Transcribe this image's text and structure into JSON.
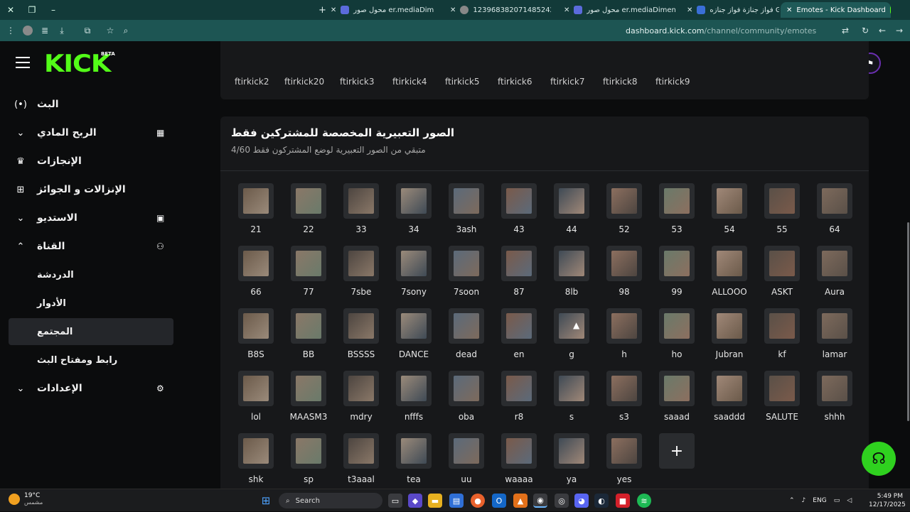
{
  "browser": {
    "tabs": [
      {
        "title": "Emotes - Kick Dashboard",
        "active": true
      },
      {
        "title": "فواز جنازة فواز جنازه GIF - فواز جـ",
        "active": false
      },
      {
        "title": "محول صور er.mediaDimension",
        "active": false
      },
      {
        "title": "1239683820714852424.webp (",
        "active": false
      },
      {
        "title": "محول صور er.mediaDimension",
        "active": false
      }
    ],
    "url_host": "dashboard.kick.com",
    "url_path": "/channel/community/emotes"
  },
  "header": {
    "logo": "KICK",
    "beta": "BETA"
  },
  "sidebar": {
    "items": [
      {
        "label": "البث",
        "icon": "live-icon"
      },
      {
        "label": "الربح المادي",
        "icon": "chart-icon",
        "chevron": "down"
      },
      {
        "label": "الإنجازات",
        "icon": "trophy-icon"
      },
      {
        "label": "الإنزالات و الجوائز",
        "icon": "gift-icon"
      },
      {
        "label": "الاستديو",
        "icon": "studio-icon",
        "chevron": "down"
      },
      {
        "label": "القناة",
        "icon": "users-icon",
        "chevron": "up"
      },
      {
        "label": "الدردشة"
      },
      {
        "label": "الأدوار"
      },
      {
        "label": "المجتمع"
      },
      {
        "label": "رابط ومفتاح البث"
      },
      {
        "label": "الإعدادات",
        "icon": "gear-icon",
        "chevron": "down"
      }
    ]
  },
  "previous_section": {
    "labels": [
      "ftirkick2",
      "ftirkick20",
      "ftirkick3",
      "ftirkick4",
      "ftirkick5",
      "ftirkick6",
      "ftirkick7",
      "ftirkick8",
      "ftirkick9"
    ]
  },
  "subscriber_emotes": {
    "title": "الصور التعبيرية المخصصة للمشتركين فقط",
    "subtitle": "متبقي من الصور التعبيرية لوضع المشتركون فقط 4/60",
    "emotes": [
      "21",
      "22",
      "33",
      "34",
      "3ash",
      "43",
      "44",
      "52",
      "53",
      "54",
      "55",
      "64",
      "66",
      "77",
      "7sbe",
      "7sony",
      "7soon",
      "87",
      "8lb",
      "98",
      "99",
      "ALLOOO",
      "ASKT",
      "Aura",
      "B8S",
      "BB",
      "BSSSS",
      "DANCE",
      "dead",
      "en",
      "g",
      "h",
      "ho",
      "Jubran",
      "kf",
      "lamar",
      "lol",
      "MAASM3",
      "mdry",
      "nfffs",
      "oba",
      "r8",
      "s",
      "s3",
      "saaad",
      "saaddd",
      "SALUTE",
      "shhh",
      "shk",
      "sp",
      "t3aaal",
      "tea",
      "uu",
      "waaaa",
      "ya",
      "yes"
    ],
    "add_symbol": "+"
  },
  "taskbar": {
    "weather_temp": "19°C",
    "weather_desc": "مشمس",
    "search_placeholder": "Search",
    "lang": "ENG",
    "time": "5:49 PM",
    "date": "12/17/2025"
  },
  "colors": {
    "brand": "#53fc18",
    "support": "#2fd11f"
  }
}
